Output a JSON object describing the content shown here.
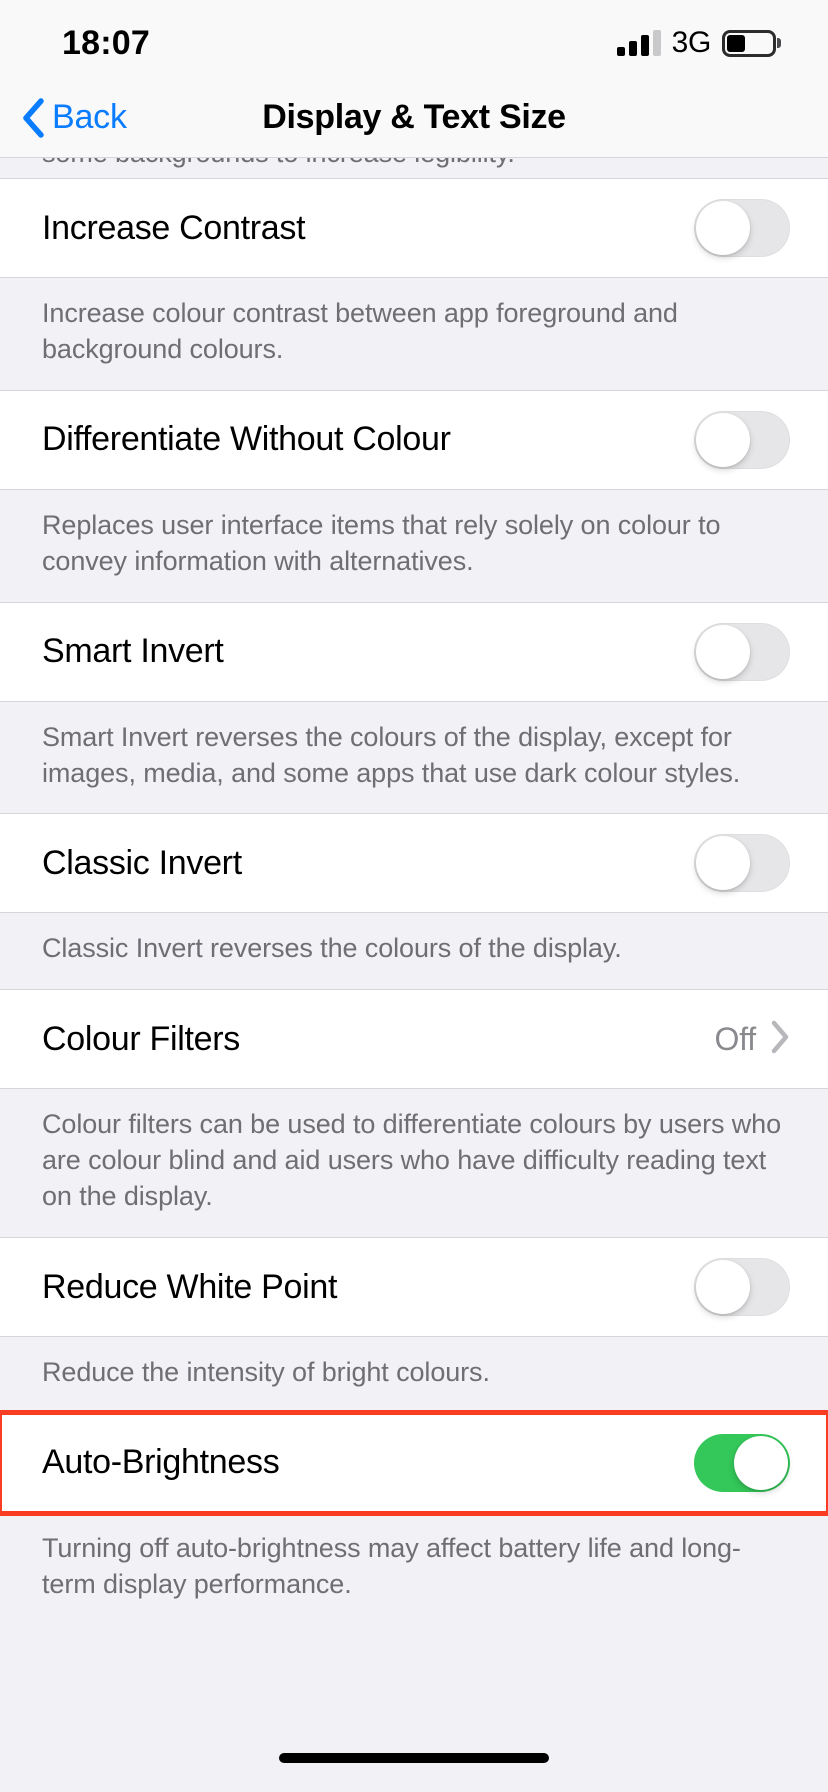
{
  "status_bar": {
    "time": "18:07",
    "carrier": "3G",
    "signal_bars_filled": 3,
    "signal_bars_total": 4,
    "battery_percent": 40
  },
  "nav": {
    "back_label": "Back",
    "title": "Display & Text Size"
  },
  "colors": {
    "accent_blue": "#0A7CFF",
    "toggle_on_green": "#34C759",
    "toggle_off_gray": "#E6E6E8",
    "highlight_red": "#F83D22",
    "group_background": "#F2F1F6",
    "row_background": "#FFFFFF",
    "footer_text": "#6E6E73",
    "value_text": "#8A8A8E"
  },
  "clipped_footer": {
    "text": "some backgrounds to increase legibility."
  },
  "rows": [
    {
      "label": "Increase Contrast",
      "control": "toggle",
      "state": "off",
      "footer": "Increase colour contrast between app foreground and background colours."
    },
    {
      "label": "Differentiate Without Colour",
      "control": "toggle",
      "state": "off",
      "footer": "Replaces user interface items that rely solely on colour to convey information with alternatives."
    },
    {
      "label": "Smart Invert",
      "control": "toggle",
      "state": "off",
      "footer": "Smart Invert reverses the colours of the display, except for images, media, and some apps that use dark colour styles."
    },
    {
      "label": "Classic Invert",
      "control": "toggle",
      "state": "off",
      "footer": "Classic Invert reverses the colours of the display."
    },
    {
      "label": "Colour Filters",
      "control": "disclosure",
      "value": "Off",
      "footer": "Colour filters can be used to differentiate colours by users who are colour blind and aid users who have difficulty reading text on the display."
    },
    {
      "label": "Reduce White Point",
      "control": "toggle",
      "state": "off",
      "footer": "Reduce the intensity of bright colours."
    },
    {
      "label": "Auto-Brightness",
      "control": "toggle",
      "state": "on",
      "highlighted": true,
      "footer": "Turning off auto-brightness may affect battery life and long-term display performance."
    }
  ]
}
